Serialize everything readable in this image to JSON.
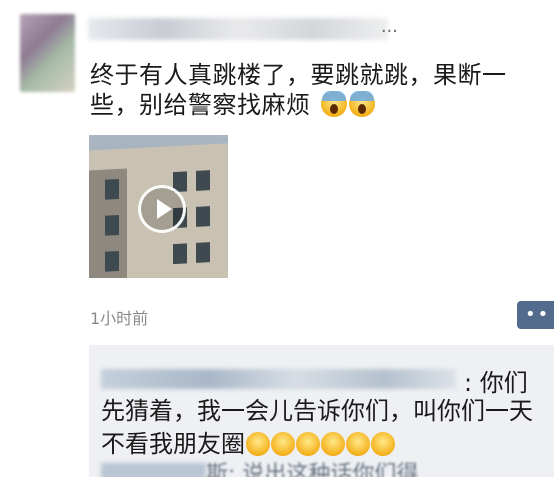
{
  "post": {
    "text_line1": "终于有人真跳楼了，要跳就跳，果断一",
    "text_line2": "些，别给警察找麻烦",
    "emojis": [
      "scream-emoji",
      "scream-emoji"
    ],
    "time": "1小时前"
  },
  "comment": {
    "tail_label": ": 你们",
    "body": "先猜着，我一会儿告诉你们，叫你们一天不看我朋友圈",
    "second_partial": "斯: 说出这种话你们得"
  },
  "icons": {
    "play": "play-icon",
    "more": "more-icon"
  }
}
